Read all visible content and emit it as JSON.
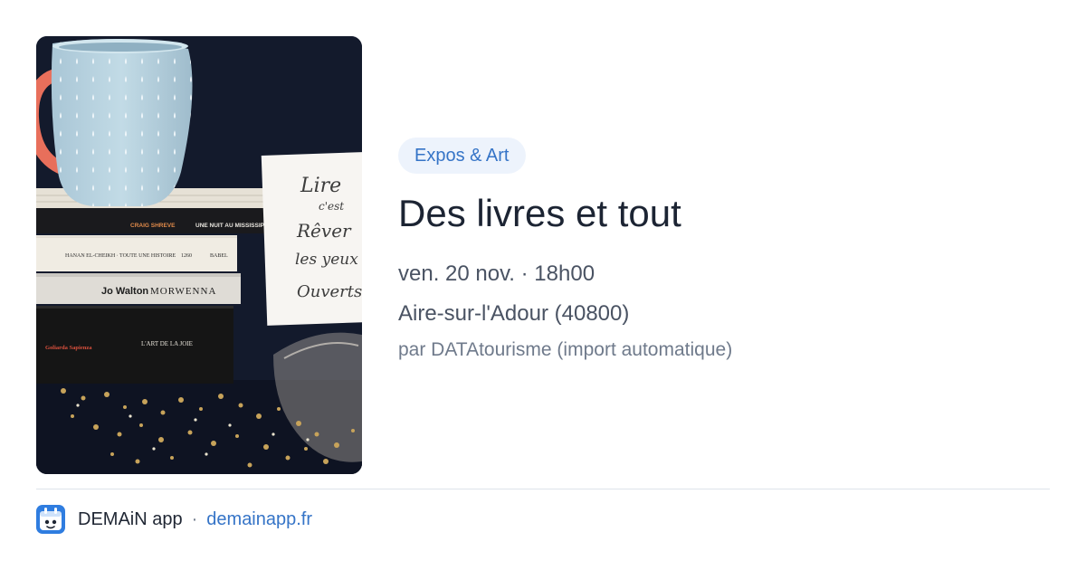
{
  "event": {
    "category": "Expos & Art",
    "title": "Des livres et tout",
    "datetime": "ven. 20 nov. · 18h00",
    "location": "Aire-sur-l'Adour (40800)",
    "source": "par DATAtourisme (import automatique)"
  },
  "image": {
    "book_spines": [
      "CRAIG SHREVE",
      "UNE NUIT AU MISSISSIPPI",
      "HANAN EL-CHEIKH · TOUTE UNE HISTOIRE",
      "1260",
      "BABEL",
      "Jo Walton",
      "MORWENNA",
      "Goliarda Sapienza",
      "L'ART DE LA JOIE"
    ],
    "card_lines": [
      "Lire",
      "c'est",
      "Rêver",
      "les yeux",
      "Ouverts"
    ]
  },
  "footer": {
    "app_name": "DEMAiN app",
    "separator": "·",
    "site": "demainapp.fr"
  },
  "colors": {
    "accent": "#3574c7",
    "tag_background": "#edf3fc",
    "divider": "#dde4ea"
  }
}
